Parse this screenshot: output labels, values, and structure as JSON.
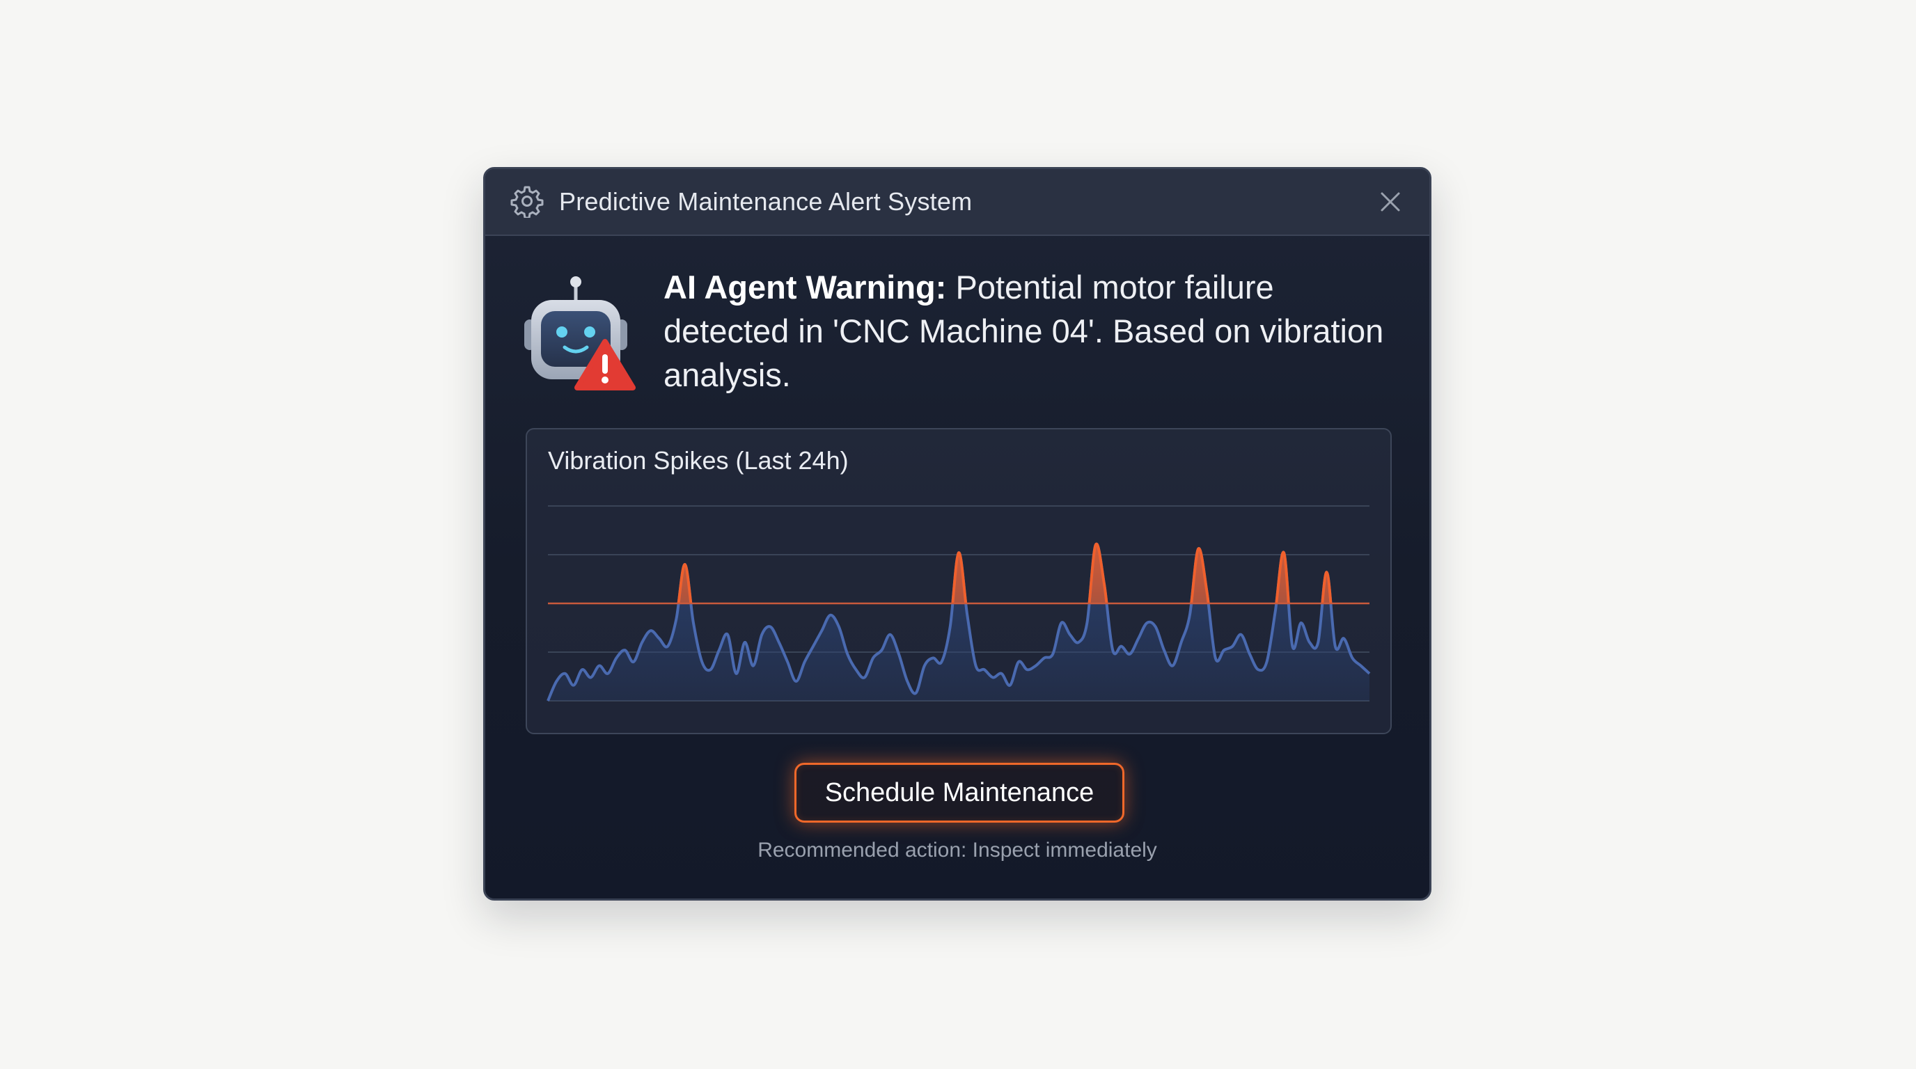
{
  "window": {
    "title": "Predictive Maintenance Alert System",
    "icon": "gear-icon",
    "close_icon": "close-icon"
  },
  "alert": {
    "icon": "robot-warning-icon",
    "prefix": "AI Agent Warning:",
    "message": " Potential motor failure detected in 'CNC Machine 04'. Based on vibration analysis."
  },
  "chart": {
    "title": "Vibration Spikes (Last 24h)"
  },
  "chart_data": {
    "type": "area",
    "title": "Vibration Spikes (Last 24h)",
    "xlabel": "",
    "ylabel": "",
    "ylim": [
      0,
      100
    ],
    "grid": true,
    "threshold": 50,
    "x": [
      0,
      1,
      2,
      3,
      4,
      5,
      6,
      7,
      8,
      9,
      10,
      11,
      12,
      13,
      14,
      15,
      16,
      17,
      18,
      19,
      20,
      21,
      22,
      23,
      24,
      25,
      26,
      27,
      28,
      29,
      30,
      31,
      32,
      33,
      34,
      35,
      36,
      37,
      38,
      39,
      40,
      41,
      42,
      43,
      44,
      45,
      46,
      47,
      48,
      49,
      50,
      51,
      52,
      53,
      54,
      55,
      56,
      57,
      58,
      59,
      60,
      61,
      62,
      63,
      64,
      65,
      66,
      67,
      68,
      69,
      70,
      71,
      72,
      73,
      74,
      75,
      76,
      77,
      78,
      79,
      80,
      81,
      82,
      83,
      84,
      85,
      86,
      87,
      88,
      89,
      90,
      91,
      92,
      93,
      94,
      95,
      96
    ],
    "series": [
      {
        "values": [
          0,
          10,
          14,
          8,
          16,
          12,
          18,
          14,
          22,
          26,
          20,
          30,
          36,
          32,
          28,
          42,
          70,
          40,
          20,
          16,
          26,
          34,
          14,
          30,
          18,
          34,
          38,
          30,
          20,
          10,
          20,
          28,
          36,
          44,
          38,
          24,
          16,
          12,
          22,
          26,
          34,
          24,
          10,
          4,
          18,
          22,
          20,
          38,
          76,
          44,
          18,
          16,
          12,
          14,
          8,
          20,
          16,
          18,
          22,
          24,
          40,
          34,
          30,
          40,
          80,
          60,
          26,
          28,
          24,
          32,
          40,
          38,
          26,
          18,
          30,
          44,
          78,
          56,
          22,
          26,
          28,
          34,
          24,
          16,
          20,
          46,
          76,
          28,
          40,
          30,
          30,
          66,
          28,
          32,
          22,
          18,
          14
        ]
      }
    ],
    "colors": {
      "line": "#4a6ab0",
      "fill": "#2c4577",
      "spike": "#f0602c",
      "threshold": "#c95a3c"
    }
  },
  "actions": {
    "schedule_label": "Schedule Maintenance",
    "recommendation": "Recommended action: Inspect immediately"
  }
}
